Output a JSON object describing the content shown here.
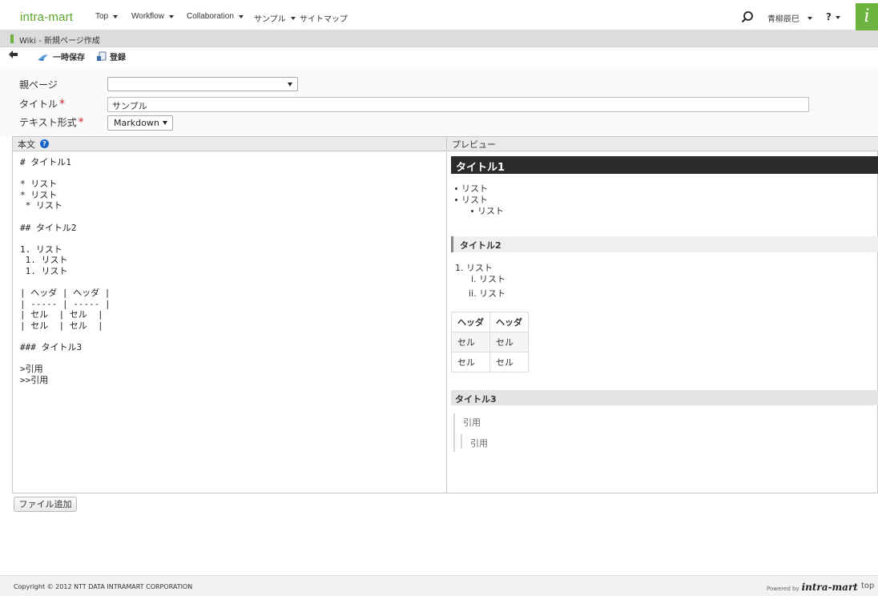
{
  "nav": {
    "logo": "intra-mart",
    "menu": [
      "Top",
      "Workflow",
      "Collaboration",
      "サンプル",
      "サイトマップ"
    ],
    "user": "青柳辰巳",
    "help": "?",
    "brand_icon": "i"
  },
  "page": {
    "title": "Wiki - 新規ページ作成"
  },
  "toolbar": {
    "save_temp": "一時保存",
    "register": "登録"
  },
  "form": {
    "parent_label": "親ページ",
    "parent_value": "",
    "title_label": "タイトル",
    "title_value": "サンプル",
    "format_label": "テキスト形式",
    "format_value": "Markdown",
    "required_mark": "*"
  },
  "editor": {
    "body_header": "本文",
    "preview_header": "プレビュー",
    "source_lines": [
      "# タイトル1",
      "",
      "* リスト",
      "* リスト",
      " * リスト",
      "",
      "## タイトル2",
      "",
      "1. リスト",
      " 1. リスト",
      " 1. リスト",
      "",
      "| ヘッダ | ヘッダ |",
      "| ----- | ----- |",
      "| セル  | セル  |",
      "| セル  | セル  |",
      "",
      "### タイトル3",
      "",
      ">引用",
      ">>引用"
    ]
  },
  "preview": {
    "h1": "タイトル1",
    "bullets": [
      "リスト",
      "リスト"
    ],
    "sub_bullet": "リスト",
    "h2": "タイトル2",
    "ol_item": "1. リスト",
    "ol_sub": [
      "i. リスト",
      "ii. リスト"
    ],
    "table_headers": [
      "ヘッダ",
      "ヘッダ"
    ],
    "table_rows": [
      [
        "セル",
        "セル"
      ],
      [
        "セル",
        "セル"
      ]
    ],
    "h3": "タイトル3",
    "quote1": "引用",
    "quote2": "引用"
  },
  "buttons": {
    "add_file": "ファイル追加"
  },
  "footer": {
    "copyright": "Copyright © 2012 NTT DATA INTRAMART CORPORATION",
    "powered_by": "Powered by",
    "powered_brand": "intra-mart",
    "top_link": "top"
  }
}
